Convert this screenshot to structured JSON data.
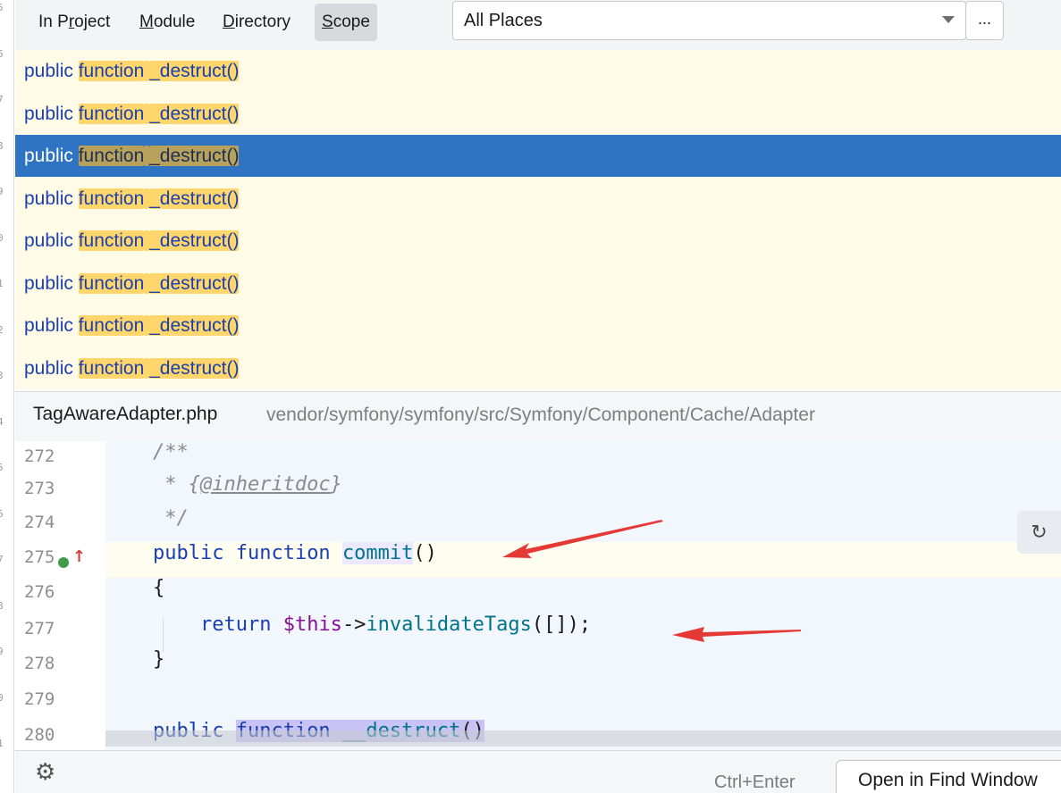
{
  "gutter_marks": [
    "5",
    "6",
    "7",
    "8",
    "9",
    "0",
    "1",
    "2",
    "3",
    "4",
    "5",
    "6",
    "7",
    "8",
    "9",
    "0",
    "1"
  ],
  "scope": {
    "tabs": [
      {
        "label": "In Project",
        "mnemonic_index": 4
      },
      {
        "label": "Module",
        "mnemonic_index": 0
      },
      {
        "label": "Directory",
        "mnemonic_index": 0
      },
      {
        "label": "Scope",
        "mnemonic_index": 0
      }
    ],
    "active_tab": "Scope",
    "selected_value": "All Places",
    "more_label": "..."
  },
  "results": [
    {
      "prefix": "public",
      "match1": "function",
      "match2": "_destruct()",
      "selected": false
    },
    {
      "prefix": "public",
      "match1": "function",
      "match2": "_destruct()",
      "selected": false
    },
    {
      "prefix": "public",
      "match1": "function",
      "match2": "_destruct()",
      "selected": true
    },
    {
      "prefix": "public",
      "match1": "function",
      "match2": "_destruct()",
      "selected": false
    },
    {
      "prefix": "public",
      "match1": "function",
      "match2": "_destruct()",
      "selected": false
    },
    {
      "prefix": "public",
      "match1": "function",
      "match2": "_destruct()",
      "selected": false
    },
    {
      "prefix": "public",
      "match1": "function",
      "match2": "_destruct()",
      "selected": false
    },
    {
      "prefix": "public",
      "match1": "function",
      "match2": "_destruct()",
      "selected": false
    }
  ],
  "preview": {
    "file_name": "TagAwareAdapter.php",
    "file_path": "vendor/symfony/symfony/src/Symfony/Component/Cache/Adapter",
    "line_numbers": [
      "272",
      "273",
      "274",
      "275",
      "276",
      "277",
      "278",
      "279",
      "280"
    ],
    "code": {
      "l272": "/**",
      "l273_pre": " * {",
      "l273_doc": "@inheritdoc",
      "l273_post": "}",
      "l274": " */",
      "l275_kw1": "public",
      "l275_kw2": "function",
      "l275_name": "commit",
      "l275_rest": "()",
      "l276": "{",
      "l277_kw": "return",
      "l277_var": "$this",
      "l277_arrow": "->",
      "l277_fn": "invalidateTags",
      "l277_rest": "([]);",
      "l278": "}",
      "l280_kw1": "public",
      "l280_kw2": "function",
      "l280_name": "__destruct",
      "l280_rest": "()"
    },
    "wrap_icon": "soft-wrap-icon",
    "marker_arrow": "↑"
  },
  "footer": {
    "settings_icon": "gear-icon",
    "shortcut": "Ctrl+Enter",
    "open_button": "Open in Find Window"
  },
  "colors": {
    "selection": "#2f74c2",
    "match_highlight": "#ffd66b",
    "keyword": "#1a3fae",
    "annotation_arrow": "#e53935"
  }
}
